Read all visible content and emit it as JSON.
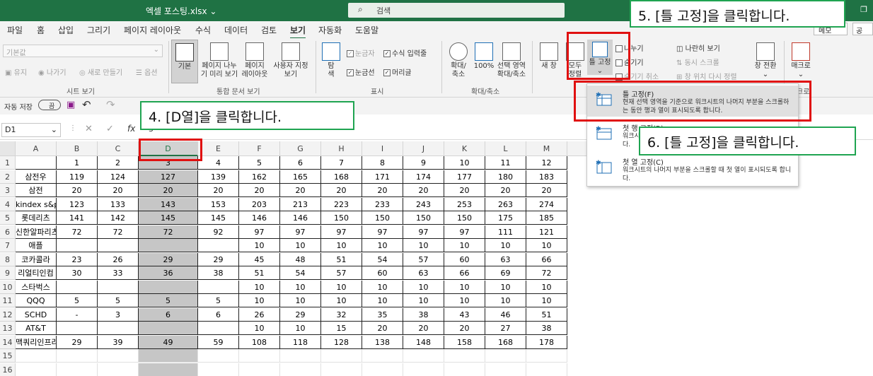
{
  "titlebar": {
    "title": "엑셀 포스팅.xlsx ⌄",
    "search_placeholder": "검색"
  },
  "tabs": [
    "파일",
    "홈",
    "삽입",
    "그리기",
    "페이지 레이아웃",
    "수식",
    "데이터",
    "검토",
    "보기",
    "자동화",
    "도움말"
  ],
  "active_tab": "보기",
  "header_buttons": {
    "memo": "메모",
    "share": "공"
  },
  "ribbon": {
    "sheet_view": {
      "style_value": "기본값",
      "keep": "유지",
      "exit": "나가기",
      "new": "새로 만들기",
      "options": "옵션",
      "group": "시트 보기"
    },
    "workbook_view": {
      "normal": "기본",
      "page_break_1": "페이지 나누",
      "page_break_2": "기 미리 보기",
      "page_layout_1": "페이지",
      "page_layout_2": "레이아웃",
      "custom_1": "사용자 지정",
      "custom_2": "보기",
      "group": "통합 문서 보기"
    },
    "show": {
      "nav_1": "탐",
      "nav_2": "색",
      "ruler": "눈금자",
      "formula_bar": "수식 입력줄",
      "gridlines": "눈금선",
      "headings": "머리글",
      "group": "표시"
    },
    "zoom": {
      "zoom_1": "확대/",
      "zoom_2": "축소",
      "zoom100": "100%",
      "zoom_sel_1": "선택 영역",
      "zoom_sel_2": "확대/축소",
      "group": "확대/축소"
    },
    "window": {
      "new_window": "새 창",
      "arrange_1": "모두",
      "arrange_2": "정렬",
      "freeze": "틀 고정",
      "split": "나누기",
      "hide": "숨기기",
      "unhide": "숨기기 취소",
      "side_by_side": "나란히 보기",
      "sync_scroll": "동시 스크롤",
      "reset_pos": "창 위치 다시 정렬",
      "switch_1": "창 전환",
      "macro": "매크로",
      "macro_group": "크로"
    }
  },
  "qat": {
    "autosave": "자동 저장",
    "toggle": "끔"
  },
  "namebox": "D1",
  "fx": "fx",
  "formula_value": "3",
  "columns": [
    "A",
    "B",
    "C",
    "D",
    "E",
    "F",
    "G",
    "H",
    "I",
    "J",
    "K",
    "L",
    "M"
  ],
  "selected_column": "D",
  "rows": [
    [
      "",
      "1",
      "2",
      "3",
      "4",
      "5",
      "6",
      "7",
      "8",
      "9",
      "10",
      "11",
      "12"
    ],
    [
      "삼전우",
      "119",
      "124",
      "127",
      "139",
      "162",
      "165",
      "168",
      "171",
      "174",
      "177",
      "180",
      "183"
    ],
    [
      "삼전",
      "20",
      "20",
      "20",
      "20",
      "20",
      "20",
      "20",
      "20",
      "20",
      "20",
      "20",
      "20"
    ],
    [
      "kindex s&p",
      "123",
      "133",
      "143",
      "153",
      "203",
      "213",
      "223",
      "233",
      "243",
      "253",
      "263",
      "274"
    ],
    [
      "롯데리츠",
      "141",
      "142",
      "145",
      "145",
      "146",
      "146",
      "150",
      "150",
      "150",
      "150",
      "175",
      "185"
    ],
    [
      "신한알파리츠",
      "72",
      "72",
      "72",
      "92",
      "97",
      "97",
      "97",
      "97",
      "97",
      "97",
      "111",
      "121"
    ],
    [
      "애플",
      "",
      "",
      "",
      "",
      "10",
      "10",
      "10",
      "10",
      "10",
      "10",
      "10",
      "10"
    ],
    [
      "코카콜라",
      "23",
      "26",
      "29",
      "29",
      "45",
      "48",
      "51",
      "54",
      "57",
      "60",
      "63",
      "66"
    ],
    [
      "리얼티인컴",
      "30",
      "33",
      "36",
      "38",
      "51",
      "54",
      "57",
      "60",
      "63",
      "66",
      "69",
      "72"
    ],
    [
      "스타벅스",
      "",
      "",
      "",
      "",
      "10",
      "10",
      "10",
      "10",
      "10",
      "10",
      "10",
      "10"
    ],
    [
      "QQQ",
      "5",
      "5",
      "5",
      "5",
      "10",
      "10",
      "10",
      "10",
      "10",
      "10",
      "10",
      "10"
    ],
    [
      "SCHD",
      "-",
      "3",
      "6",
      "6",
      "26",
      "29",
      "32",
      "35",
      "38",
      "43",
      "46",
      "51"
    ],
    [
      "AT&T",
      "",
      "",
      "",
      "",
      "10",
      "10",
      "15",
      "20",
      "20",
      "20",
      "27",
      "38"
    ],
    [
      "맥쿼리인프라",
      "29",
      "39",
      "49",
      "59",
      "108",
      "118",
      "128",
      "138",
      "148",
      "158",
      "168",
      "178"
    ],
    [
      "",
      "",
      "",
      "",
      "",
      "",
      "",
      "",
      "",
      "",
      "",
      "",
      ""
    ],
    [
      "",
      "",
      "",
      "",
      "",
      "",
      "",
      "",
      "",
      "",
      "",
      "",
      ""
    ]
  ],
  "dropdown": [
    {
      "title": "틀 고정(F)",
      "desc": "현재 선택 영역을 기준으로 워크시트의 나머지 부분을 스크롤하는 동안 행과 열이 표시되도록 합니다."
    },
    {
      "title": "첫 행 고정(R)",
      "desc": "워크시트의 나머지 부분을 스크롤할 때 첫 행이 표시되도록 합니다."
    },
    {
      "title": "첫 열 고정(C)",
      "desc": "워크시트의 나머지 부분을 스크롤할 때 첫 열이 표시되도록 합니다."
    }
  ],
  "callouts": {
    "step4": "4. [D열]을 클릭합니다.",
    "step5": "5. [틀 고정]을 클릭합니다.",
    "step6": "6. [틀 고정]을 클릭합니다."
  },
  "colors": {
    "excel_green": "#1f7244",
    "callout_border": "#1fa451",
    "highlight_red": "#e01010"
  }
}
